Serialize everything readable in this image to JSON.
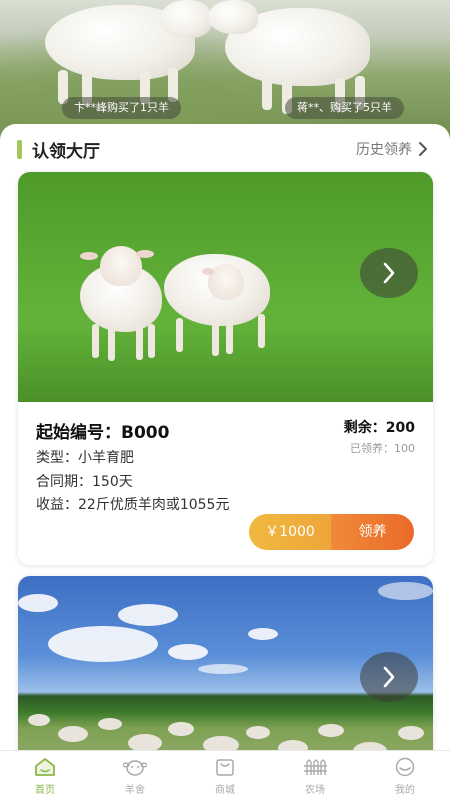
{
  "banner": {
    "tickers": [
      "卞**峰购买了1只羊",
      "蒋**、购买了5只羊"
    ]
  },
  "section": {
    "title": "认领大厅",
    "history_link": "历史领养"
  },
  "cards": [
    {
      "code_label": "起始编号：",
      "code": "B000",
      "remain_label": "剩余：",
      "remain": "200",
      "adopted_label": "已领养：",
      "adopted": "100",
      "type_text": "类型：小羊育肥",
      "period_text": "合同期：150天",
      "income_text": "收益：22斤优质羊肉或1055元",
      "price_label": "￥1000",
      "adopt_label": "领养"
    }
  ],
  "tabbar": {
    "items": [
      "首页",
      "羊舍",
      "商城",
      "农场",
      "我的"
    ],
    "active_index": 0
  },
  "colors": {
    "accent": "#a3c659",
    "active_tab": "#8bb84a",
    "price_button": "#eea63a",
    "adopt_button": "#ea6b28"
  }
}
